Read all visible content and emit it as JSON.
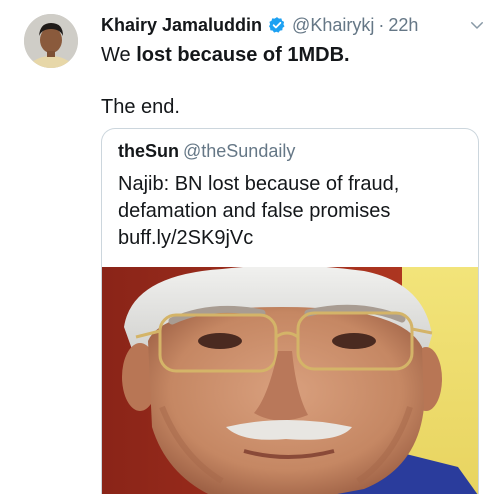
{
  "tweet": {
    "author_name": "Khairy Jamaluddin",
    "handle": "@Khairykj",
    "separator": "·",
    "time": "22h",
    "text_prefix": "We ",
    "text_bold": "lost because of 1MDB.",
    "text_line2": "The end."
  },
  "quoted_tweet": {
    "author_name": "theSun",
    "handle": "@theSundaily",
    "text_line1": "Najib: BN lost because of fraud,",
    "text_line2": "defamation and false promises",
    "link": "buff.ly/2SK9jVc"
  },
  "icons": {
    "verified": "verified-badge-icon",
    "menu": "chevron-down-icon"
  },
  "colors": {
    "primary_text": "#14171a",
    "secondary_text": "#657786",
    "verified_blue": "#1da1f2",
    "border": "#ccd6dd"
  }
}
